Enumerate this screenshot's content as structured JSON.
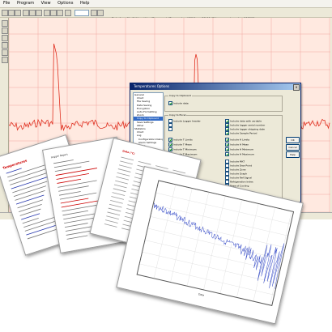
{
  "window": {
    "menu": [
      "File",
      "Program",
      "View",
      "Options",
      "Help"
    ],
    "path_text": "Data from file C:\\Users\\User\\Documents\\Temperature\\2014.csv 23:00:45 logger and number 000000"
  },
  "chart": {
    "line_color": "#e03020",
    "grid_color": "#f2a8a0",
    "background": "#ffe9e0",
    "legend_text": "temperature"
  },
  "dialog": {
    "title": "Temperatures Options",
    "close_label": "x",
    "tree_items": [
      "General",
      "Chart",
      "File Saving",
      "Data Saving",
      "Encryption",
      "Auto-Formatting",
      "Zoom",
      "Copy to Clipboard",
      "Save Settings",
      "Other",
      "Statistics",
      "Chart",
      "Log",
      "Configuration Dialog",
      "Alarm Settings",
      "Email",
      "Users and Rooms"
    ],
    "selected_tree_index": 7,
    "group1_title": "Copy to Clipboard",
    "group1_items": [
      {
        "label": "Include data",
        "checked": true
      }
    ],
    "group2_title": "Copy to Excel",
    "group2_left": [
      {
        "label": "Include Logger header",
        "checked": false
      },
      {
        "label": "",
        "checked": false
      },
      {
        "label": "",
        "checked": false
      },
      {
        "label": "Include T Limits",
        "checked": true
      },
      {
        "label": "Include T Mean",
        "checked": true
      },
      {
        "label": "Include T Minimum",
        "checked": true
      },
      {
        "label": "Include T Maximum",
        "checked": true
      }
    ],
    "group2_right": [
      {
        "label": "Include data with variable",
        "checked": true
      },
      {
        "label": "Include logger serial number",
        "checked": true
      },
      {
        "label": "Include logger shipping date",
        "checked": true
      },
      {
        "label": "Include Sample Period",
        "checked": true
      },
      {
        "label": "Include H Limits",
        "checked": true
      },
      {
        "label": "Include H Mean",
        "checked": true
      },
      {
        "label": "Include H Minimum",
        "checked": true
      },
      {
        "label": "Include H Maximum",
        "checked": true
      },
      {
        "label": "Include MKT",
        "checked": false
      },
      {
        "label": "Include Dew Point",
        "checked": false
      },
      {
        "label": "Include Zone",
        "checked": false
      },
      {
        "label": "Include Graph",
        "checked": false
      },
      {
        "label": "Include Ref Signal",
        "checked": false
      },
      {
        "label": "Refrigeration Index",
        "checked": false
      },
      {
        "label": "Base of Cooling",
        "checked": false
      }
    ],
    "buttons": [
      "OK",
      "Cancel",
      "Help"
    ]
  },
  "papers": {
    "paper1_title": "Temperatures",
    "paper2_title": "Logger Report",
    "paper3_title": "Data (°C)",
    "plot_xlabel": "Date",
    "plot_line_color": "#3a4fc8"
  },
  "colors": {
    "title_red": "#cc0000",
    "link_blue": "#2233aa"
  }
}
